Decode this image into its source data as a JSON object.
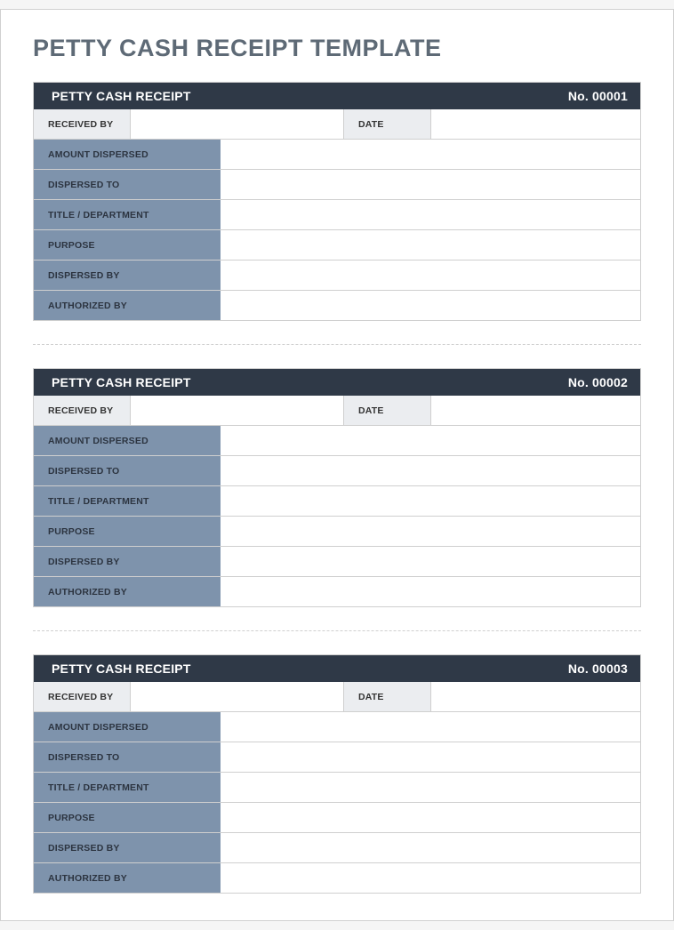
{
  "page_title": "PETTY CASH RECEIPT TEMPLATE",
  "receipts": [
    {
      "header_title": "PETTY CASH RECEIPT",
      "number_label": "No. 00001",
      "received_by_label": "RECEIVED BY",
      "received_by_value": "",
      "date_label": "DATE",
      "date_value": "",
      "rows": [
        {
          "label": "AMOUNT DISPERSED",
          "value": ""
        },
        {
          "label": "DISPERSED TO",
          "value": ""
        },
        {
          "label": "TITLE / DEPARTMENT",
          "value": ""
        },
        {
          "label": "PURPOSE",
          "value": ""
        },
        {
          "label": "DISPERSED BY",
          "value": ""
        },
        {
          "label": "AUTHORIZED BY",
          "value": ""
        }
      ]
    },
    {
      "header_title": "PETTY CASH RECEIPT",
      "number_label": "No. 00002",
      "received_by_label": "RECEIVED BY",
      "received_by_value": "",
      "date_label": "DATE",
      "date_value": "",
      "rows": [
        {
          "label": "AMOUNT DISPERSED",
          "value": ""
        },
        {
          "label": "DISPERSED TO",
          "value": ""
        },
        {
          "label": "TITLE / DEPARTMENT",
          "value": ""
        },
        {
          "label": "PURPOSE",
          "value": ""
        },
        {
          "label": "DISPERSED BY",
          "value": ""
        },
        {
          "label": "AUTHORIZED BY",
          "value": ""
        }
      ]
    },
    {
      "header_title": "PETTY CASH RECEIPT",
      "number_label": "No. 00003",
      "received_by_label": "RECEIVED BY",
      "received_by_value": "",
      "date_label": "DATE",
      "date_value": "",
      "rows": [
        {
          "label": "AMOUNT DISPERSED",
          "value": ""
        },
        {
          "label": "DISPERSED TO",
          "value": ""
        },
        {
          "label": "TITLE / DEPARTMENT",
          "value": ""
        },
        {
          "label": "PURPOSE",
          "value": ""
        },
        {
          "label": "DISPERSED BY",
          "value": ""
        },
        {
          "label": "AUTHORIZED BY",
          "value": ""
        }
      ]
    }
  ]
}
